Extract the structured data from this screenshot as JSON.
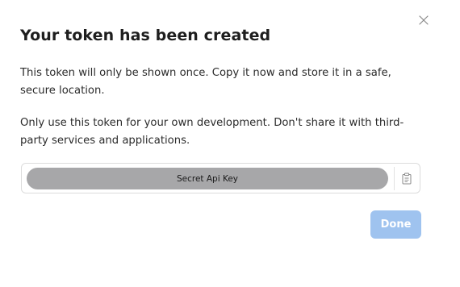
{
  "dialog": {
    "title": "Your token has been created",
    "paragraph_1": "This token will only be shown once. Copy it now and store it in a safe, secure location.",
    "paragraph_2": "Only use this token for your own development. Don't share it with third-party services and applications.",
    "close_icon": "close-icon",
    "key": {
      "label": "Secret Api Key",
      "copy_icon": "clipboard-icon"
    },
    "done_label": "Done"
  },
  "colors": {
    "key_pill": "#a7a7a9",
    "done_button": "#9fc3ef",
    "close_icon": "#8a8a8a",
    "copy_icon": "#8a8a8a"
  }
}
